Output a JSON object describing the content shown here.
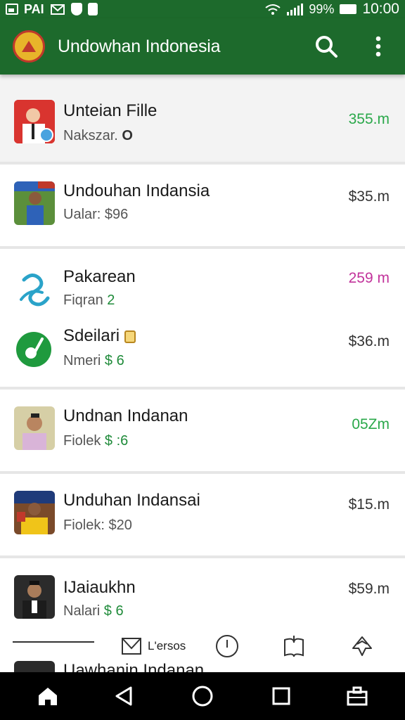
{
  "status_bar": {
    "carrier": "PAI",
    "battery_percent": "99%",
    "time": "10:00"
  },
  "app_bar": {
    "title": "Undowhan Indonesia",
    "icons": [
      "app-logo",
      "search-icon",
      "more-vert-icon"
    ]
  },
  "list": {
    "items": [
      {
        "title": "Unteian Fille",
        "subtitle": "Nakszar. ",
        "subtitle_suffix": "O",
        "amount": "355.m",
        "amount_color": "#2aa84a",
        "highlighted": true
      },
      {
        "title": "Undouhan Indansia",
        "subtitle": "Ualar: $96",
        "subtitle_suffix": "",
        "amount": "$35.m",
        "amount_color": "#333333",
        "highlighted": false
      },
      {
        "title": "Pakarean",
        "subtitle": "Fiqran ",
        "subtitle_suffix": "2",
        "amount": "259 m",
        "amount_color": "#c2339b",
        "highlighted": false
      },
      {
        "title": "Sdeilari",
        "subtitle": "Nmeri ",
        "subtitle_suffix": "$ 6",
        "amount": "$36.m",
        "amount_color": "#333333",
        "highlighted": false
      },
      {
        "title": "Undnan Indanan",
        "subtitle": "Fiolek ",
        "subtitle_suffix": "$ :6",
        "amount": "05Zm",
        "amount_color": "#2aa84a",
        "highlighted": false
      },
      {
        "title": "Unduhan Indansai",
        "subtitle": "Fiolek: $20",
        "subtitle_suffix": "",
        "amount": "$15.m",
        "amount_color": "#333333",
        "highlighted": false
      },
      {
        "title": "IJaiaukhn",
        "subtitle": "Nalari ",
        "subtitle_suffix": "$ 6",
        "amount": "$59.m",
        "amount_color": "#333333",
        "highlighted": false
      }
    ],
    "peek_title": "Uawhanin Indanan"
  },
  "bottom_tabs": {
    "items": [
      {
        "label": "L'ersos",
        "icon": "mail-icon"
      },
      {
        "label": "",
        "icon": "clock-icon"
      },
      {
        "label": "",
        "icon": "book-icon"
      },
      {
        "label": "",
        "icon": "recycle-icon"
      }
    ]
  },
  "nav_bar": {
    "icons": [
      "home-icon",
      "back-icon",
      "circle-home-icon",
      "recents-icon",
      "briefcase-icon"
    ]
  },
  "colors": {
    "primary": "#1d6a2c",
    "accent_green": "#2aa84a",
    "accent_magenta": "#c2339b"
  }
}
